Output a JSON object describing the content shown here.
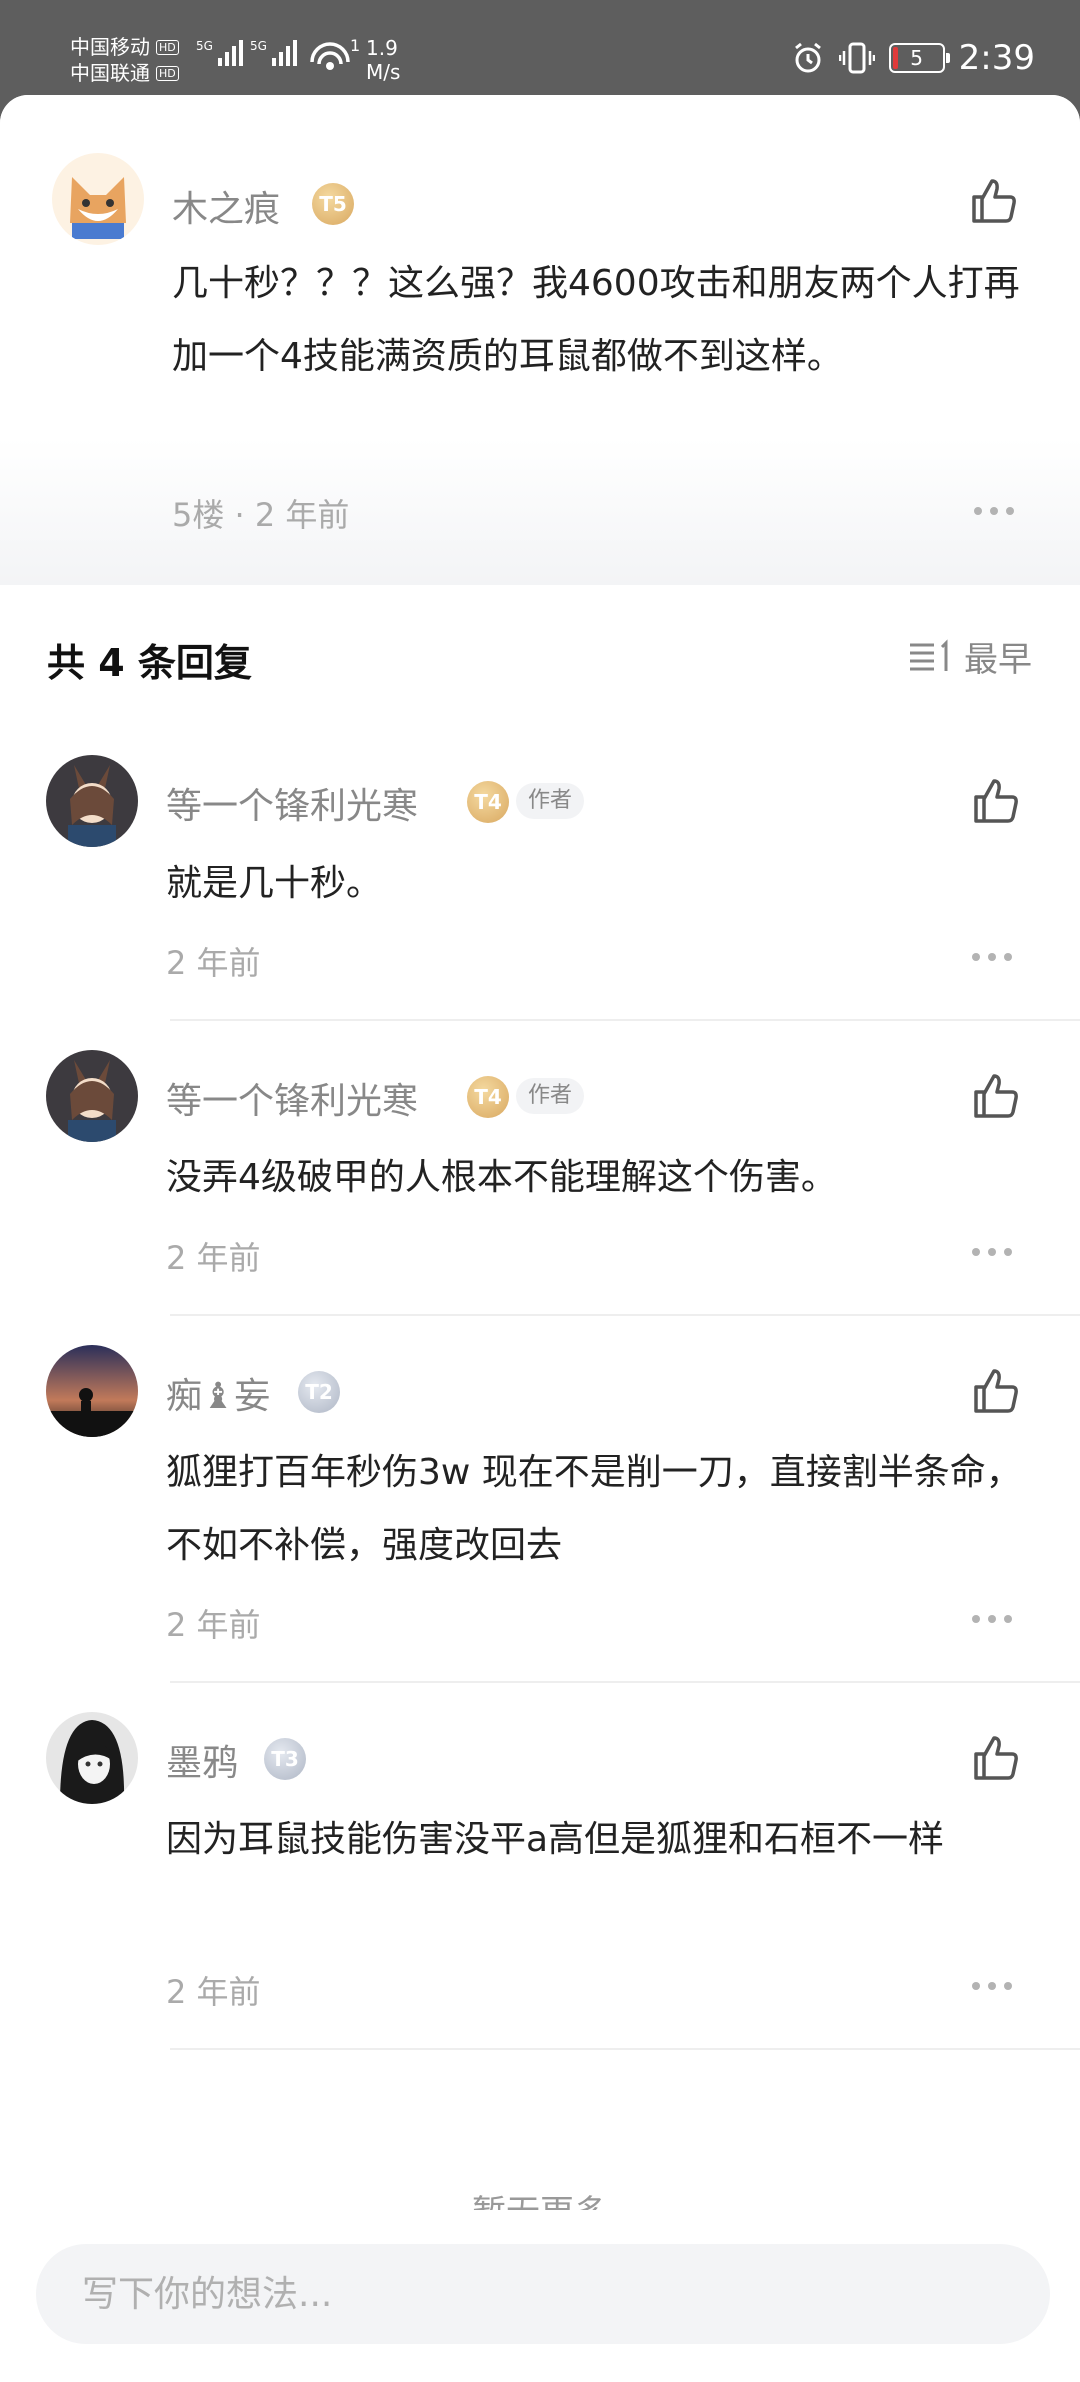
{
  "status_bar": {
    "carrier1": "中国移动",
    "carrier2": "中国联通",
    "hd": "HD",
    "net1": "5G",
    "net2": "5G",
    "wifi_sup": "1",
    "speed_value": "1.9",
    "speed_unit": "M/s",
    "battery": "5",
    "time": "2:39"
  },
  "main_comment": {
    "author": "木之痕",
    "level": "T5",
    "text": "几十秒？？？这么强？我4600攻击和朋友两个人打再加一个4技能满资质的耳鼠都做不到这样。",
    "meta": "5楼 · 2 年前"
  },
  "replies_header": {
    "title": "共 4 条回复",
    "sort_label": "最早"
  },
  "replies": [
    {
      "author": "等一个锋利光寒",
      "level": "T4",
      "author_tag": "作者",
      "text": "就是几十秒。",
      "time": "2 年前"
    },
    {
      "author": "等一个锋利光寒",
      "level": "T4",
      "author_tag": "作者",
      "text": "没弄4级破甲的人根本不能理解这个伤害。",
      "time": "2 年前"
    },
    {
      "author": "痴♝妄",
      "level": "T2",
      "text": "狐狸打百年秒伤3w 现在不是削一刀，直接割半条命，不如不补偿，强度改回去",
      "time": "2 年前"
    },
    {
      "author": "墨鸦",
      "level": "T3",
      "text": "因为耳鼠技能伤害没平a高但是狐狸和石桓不一样",
      "time": "2 年前"
    }
  ],
  "footer": {
    "no_more": "暂无更多",
    "input_placeholder": "写下你的想法..."
  },
  "colors": {
    "meta": "#aaaaaa",
    "name": "#888888",
    "gold_badge": "#d9a860",
    "silver_badge": "#aeb6c5"
  }
}
